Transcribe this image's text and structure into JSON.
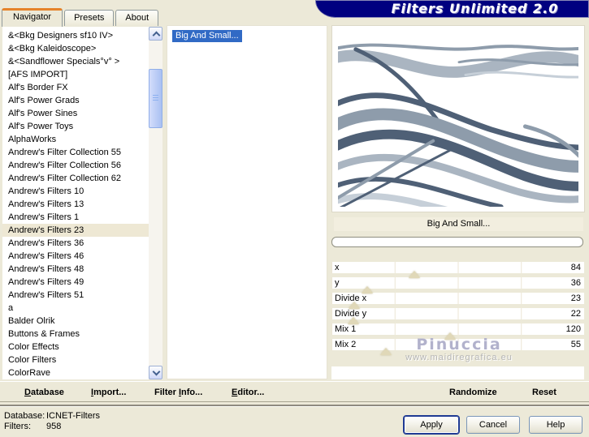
{
  "window": {
    "title": "Filters Unlimited 2.0"
  },
  "tabs": [
    {
      "label": "Navigator",
      "active": true
    },
    {
      "label": "Presets",
      "active": false
    },
    {
      "label": "About",
      "active": false
    }
  ],
  "left_list": {
    "items": [
      "&<Bkg Designers sf10 IV>",
      "&<Bkg Kaleidoscope>",
      "&<Sandflower Specials°v° >",
      "[AFS IMPORT]",
      "Alf's Border FX",
      "Alf's Power Grads",
      "Alf's Power Sines",
      "Alf's Power Toys",
      "AlphaWorks",
      "Andrew's Filter Collection 55",
      "Andrew's Filter Collection 56",
      "Andrew's Filter Collection 62",
      "Andrew's Filters 10",
      "Andrew's Filters 13",
      "Andrew's Filters 1",
      "Andrew's Filters 23",
      "Andrew's Filters 36",
      "Andrew's Filters 46",
      "Andrew's Filters 48",
      "Andrew's Filters 49",
      "Andrew's Filters 51",
      "a",
      "Balder Olrik",
      "Buttons & Frames",
      "Color Effects",
      "Color Filters",
      "ColorRave"
    ],
    "selected_index": 15
  },
  "filter_list": {
    "items": [
      "Big And Small..."
    ],
    "selected_index": 0
  },
  "params": {
    "title": "Big And Small...",
    "max": 255,
    "sliders": [
      {
        "label": "x",
        "value": 84
      },
      {
        "label": "y",
        "value": 36
      },
      {
        "label": "Divide x",
        "value": 23
      },
      {
        "label": "Divide y",
        "value": 22
      },
      {
        "label": "Mix 1",
        "value": 120
      },
      {
        "label": "Mix 2",
        "value": 55
      }
    ]
  },
  "watermark": {
    "name": "Pinuccia",
    "url": "www.maidiregrafica.eu"
  },
  "toolbar": {
    "database": {
      "pre": "",
      "key": "D",
      "post": "atabase"
    },
    "import": {
      "pre": "",
      "key": "I",
      "post": "mport..."
    },
    "filter_info": {
      "pre": "Filter ",
      "key": "I",
      "post": "nfo..."
    },
    "editor": {
      "pre": "",
      "key": "E",
      "post": "ditor..."
    },
    "randomize": "Randomize",
    "reset": "Reset"
  },
  "status": {
    "database_label": "Database:",
    "database_value": "ICNET-Filters",
    "filters_label": "Filters:",
    "filters_count": "958"
  },
  "buttons": {
    "apply": "Apply",
    "cancel": "Cancel",
    "help": "Help"
  },
  "colors": {
    "dialog_bg": "#ece9d8",
    "banner_navy": "#000080",
    "tab_orange": "#e5832a",
    "selection_blue": "#316ac5",
    "triangle_tan": "#e0d8b8",
    "watermark": "#b2b2cc",
    "band_dark": "#4f6076",
    "band_mid": "#8e9cab",
    "band_soft": "#aab5c1",
    "band_light": "#c6cfd8"
  }
}
